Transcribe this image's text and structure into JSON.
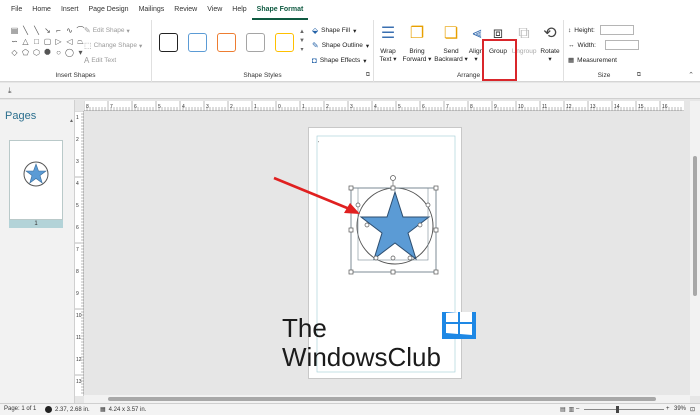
{
  "tabs": [
    "File",
    "Home",
    "Insert",
    "Page Design",
    "Mailings",
    "Review",
    "View",
    "Help",
    "Shape Format"
  ],
  "active_tab": "Shape Format",
  "ribbon": {
    "insert_shapes": {
      "label": "Insert Shapes",
      "edit_shape": "Edit Shape",
      "change_shape": "Change Shape",
      "edit_text": "Edit Text"
    },
    "shape_styles": {
      "label": "Shape Styles",
      "swatch_colors": [
        "#222222",
        "#5b9bd5",
        "#ed7d31",
        "#a5a5a5",
        "#ffc000"
      ]
    },
    "format": {
      "shape_fill": "Shape Fill",
      "shape_outline": "Shape Outline",
      "shape_effects": "Shape Effects"
    },
    "arrange": {
      "label": "Arrange",
      "wrap_text": [
        "Wrap",
        "Text"
      ],
      "bring_forward": [
        "Bring",
        "Forward"
      ],
      "send_backward": [
        "Send",
        "Backward"
      ],
      "align": "Align",
      "group": "Group",
      "ungroup": "Ungroup",
      "rotate": "Rotate"
    },
    "size": {
      "label": "Size",
      "height": "Height:",
      "width": "Width:",
      "measurement": "Measurement"
    }
  },
  "pages_pane": {
    "title": "Pages",
    "page_number": "1"
  },
  "ruler": {
    "h_labels": [
      "8",
      "7",
      "6",
      "5",
      "4",
      "3",
      "2",
      "1",
      "0",
      "1",
      "2",
      "3",
      "4",
      "5",
      "6",
      "7",
      "8",
      "9",
      "10",
      "11",
      "12",
      "13",
      "14",
      "15",
      "16"
    ],
    "v_labels": [
      "1",
      "2",
      "3",
      "4",
      "5",
      "6",
      "7",
      "8",
      "9",
      "10",
      "11",
      "12",
      "13"
    ]
  },
  "watermark": {
    "line1": "The",
    "line2": "WindowsClub"
  },
  "status": {
    "page": "Page: 1 of 1",
    "position": "2.37, 2.68 in.",
    "size": "4.24 x 3.57 in.",
    "zoom": "39%"
  },
  "colors": {
    "accent": "#0f5a41",
    "star_fill": "#5b9bd5",
    "highlight": "#d9262b",
    "arrow": "#e02020"
  }
}
